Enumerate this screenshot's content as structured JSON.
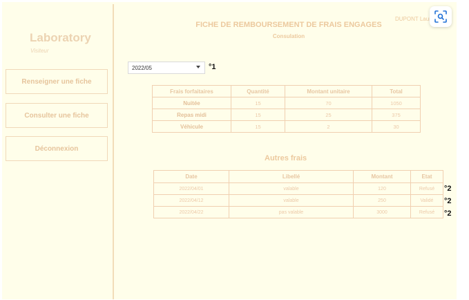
{
  "sidebar": {
    "brand": "Laboratory",
    "role": "Visiteur",
    "buttons": [
      "Renseigner une fiche",
      "Consulter une fiche",
      "Déconnexion"
    ]
  },
  "header": {
    "title": "FICHE DE REMBOURSEMENT DE FRAIS ENGAGES",
    "subtitle": "Consulation",
    "user": "DUPONT Laure"
  },
  "month_select": {
    "value": "2022/05",
    "marker": "°1"
  },
  "forfait_table": {
    "headers": [
      "Frais forfaitaires",
      "Quantité",
      "Montant unitaire",
      "Total"
    ],
    "rows": [
      [
        "Nuitée",
        "15",
        "70",
        "1050"
      ],
      [
        "Repas midi",
        "15",
        "25",
        "375"
      ],
      [
        "Véhicule",
        "15",
        "2",
        "30"
      ]
    ]
  },
  "autres_frais": {
    "title": "Autres frais",
    "headers": [
      "Date",
      "Libellé",
      "Montant",
      "Etat"
    ],
    "rows": [
      [
        "2022/04/01",
        "valable",
        "120",
        "Refusé"
      ],
      [
        "2022/04/12",
        "valable",
        "250",
        "Validé"
      ],
      [
        "2022/04/22",
        "pas valable",
        "3000",
        "Refusé"
      ]
    ],
    "markers": [
      "°2",
      "°2",
      "°2"
    ]
  },
  "icons": {
    "scan": "scan-icon",
    "dropdown": "chevron-down-icon"
  },
  "colors": {
    "background": "#fffeea",
    "accent": "#ecc99e",
    "border": "#f0cfb0",
    "scan_icon": "#1f6fd6"
  }
}
